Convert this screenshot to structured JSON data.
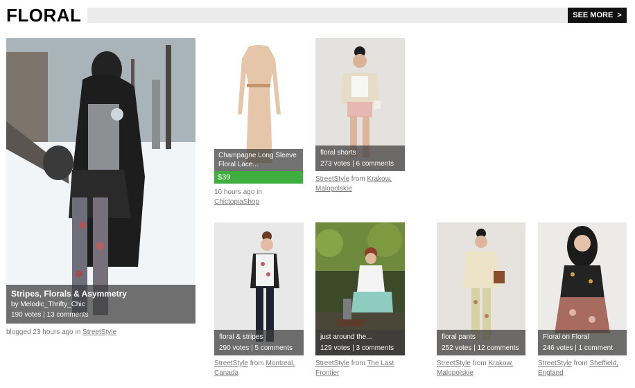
{
  "header": {
    "title": "FLORAL",
    "see_more": "SEE MORE",
    "see_more_arrow": ">"
  },
  "featured": {
    "title": "Stripes, Florals & Asymmetry",
    "by": "by Melodic_Thrifty_Chic",
    "stats": "190 votes | 13 comments",
    "caption_pre": "blogged 23 hours ago in",
    "caption_link": "StreetStyle"
  },
  "product": {
    "title": "Champagne Long Sleeve Floral Lace...",
    "price": "$39",
    "caption_pre": "10 hours ago in",
    "caption_link": "ChictopiaShop"
  },
  "items": [
    {
      "title": "floral shorts",
      "stats": "273 votes | 6 comments",
      "category": "StreetStyle",
      "from": "from",
      "location": "Krakow, Malopolskie"
    },
    {
      "title": "floral & stripes",
      "stats": "290 votes | 5 comments",
      "category": "StreetStyle",
      "from": "from",
      "location": "Montreal, Canada"
    },
    {
      "title": "just around the...",
      "stats": "129 votes | 3 comments",
      "category": "StreetStyle",
      "from": "from",
      "location": "The Last Frontier"
    },
    {
      "title": "floral pants",
      "stats": "252 votes | 12 comments",
      "category": "StreetStyle",
      "from": "from",
      "location": "Krakow, Malopolskie"
    },
    {
      "title": "Floral on Floral",
      "stats": "246 votes | 1 comment",
      "category": "StreetStyle",
      "from": "from",
      "location": "Sheffield, England"
    }
  ]
}
